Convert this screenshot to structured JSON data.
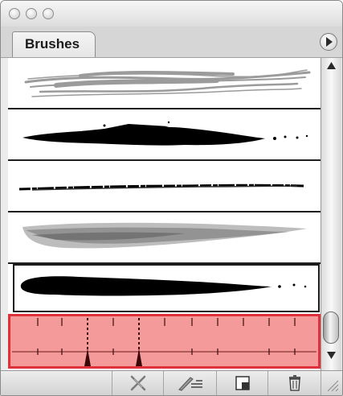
{
  "panel": {
    "tab_label": "Brushes"
  },
  "titlebar": {
    "buttons": [
      "close",
      "minimize",
      "zoom"
    ]
  },
  "brushes": [
    {
      "type": "artistic-pencil-strokes",
      "color": "#9b9b9b"
    },
    {
      "type": "charcoal-thick",
      "color": "#000000"
    },
    {
      "type": "charcoal-thin",
      "color": "#000000"
    },
    {
      "type": "chalk-gray",
      "color": "#8a8a8a"
    },
    {
      "type": "paintbrush-bold",
      "color": "#000000",
      "state": "selected"
    },
    {
      "type": "pattern-brush-ruler",
      "color": "#f49a9a",
      "state": "highlighted"
    }
  ],
  "bottom_toolbar": {
    "buttons": [
      "remove-brush-stroke-icon",
      "brush-options-icon",
      "new-brush-icon",
      "delete-brush-icon"
    ]
  },
  "colors": {
    "highlight_fill": "#f49a9a",
    "highlight_border": "#e0303a"
  }
}
